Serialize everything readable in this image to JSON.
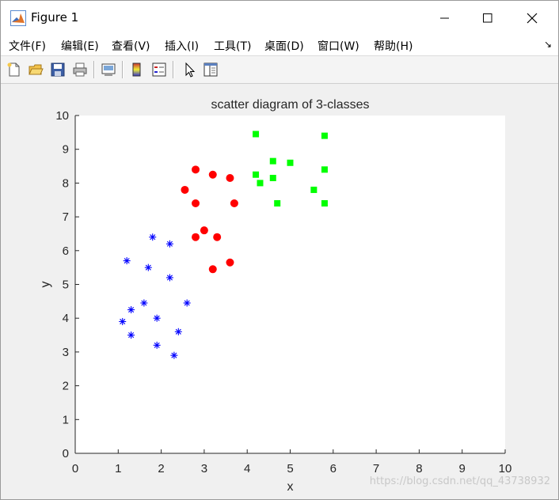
{
  "window": {
    "title": "Figure 1"
  },
  "menu": [
    "文件(F)",
    "编辑(E)",
    "查看(V)",
    "插入(I)",
    "工具(T)",
    "桌面(D)",
    "窗口(W)",
    "帮助(H)"
  ],
  "toolbar_icons": [
    "new-figure-icon",
    "open-file-icon",
    "save-icon",
    "print-icon",
    "print-preview-icon",
    "insert-colorbar-icon",
    "insert-legend-icon",
    "select-pointer-icon",
    "property-editor-icon"
  ],
  "watermark": "https://blog.csdn.net/qq_43738932",
  "chart_data": {
    "type": "scatter",
    "title": "scatter diagram of 3-classes",
    "xlabel": "x",
    "ylabel": "y",
    "xlim": [
      0,
      10
    ],
    "ylim": [
      0,
      10
    ],
    "xticks": [
      "0",
      "1",
      "2",
      "3",
      "4",
      "5",
      "6",
      "7",
      "8",
      "9",
      "10"
    ],
    "yticks": [
      "0",
      "1",
      "2",
      "3",
      "4",
      "5",
      "6",
      "7",
      "8",
      "9",
      "10"
    ],
    "grid": false,
    "series": [
      {
        "marker": "asterisk",
        "color": "#0000ff",
        "points": [
          [
            1.8,
            6.4
          ],
          [
            2.2,
            6.2
          ],
          [
            1.2,
            5.7
          ],
          [
            1.7,
            5.5
          ],
          [
            2.2,
            5.2
          ],
          [
            1.6,
            4.45
          ],
          [
            2.6,
            4.45
          ],
          [
            1.3,
            4.25
          ],
          [
            1.9,
            4.0
          ],
          [
            1.1,
            3.9
          ],
          [
            2.4,
            3.6
          ],
          [
            1.3,
            3.5
          ],
          [
            1.9,
            3.2
          ],
          [
            2.3,
            2.9
          ]
        ]
      },
      {
        "marker": "circle",
        "color": "#ff0000",
        "points": [
          [
            2.8,
            8.4
          ],
          [
            3.2,
            8.25
          ],
          [
            3.6,
            8.15
          ],
          [
            2.55,
            7.8
          ],
          [
            2.8,
            7.4
          ],
          [
            3.7,
            7.4
          ],
          [
            3.0,
            6.6
          ],
          [
            2.8,
            6.4
          ],
          [
            3.3,
            6.4
          ],
          [
            3.6,
            5.65
          ],
          [
            3.2,
            5.45
          ]
        ]
      },
      {
        "marker": "square",
        "color": "#00ff00",
        "points": [
          [
            4.2,
            9.45
          ],
          [
            5.8,
            9.4
          ],
          [
            4.6,
            8.65
          ],
          [
            5.0,
            8.6
          ],
          [
            5.8,
            8.4
          ],
          [
            4.2,
            8.25
          ],
          [
            4.6,
            8.15
          ],
          [
            4.3,
            8.0
          ],
          [
            5.55,
            7.8
          ],
          [
            4.7,
            7.4
          ],
          [
            5.8,
            7.4
          ]
        ]
      }
    ]
  }
}
